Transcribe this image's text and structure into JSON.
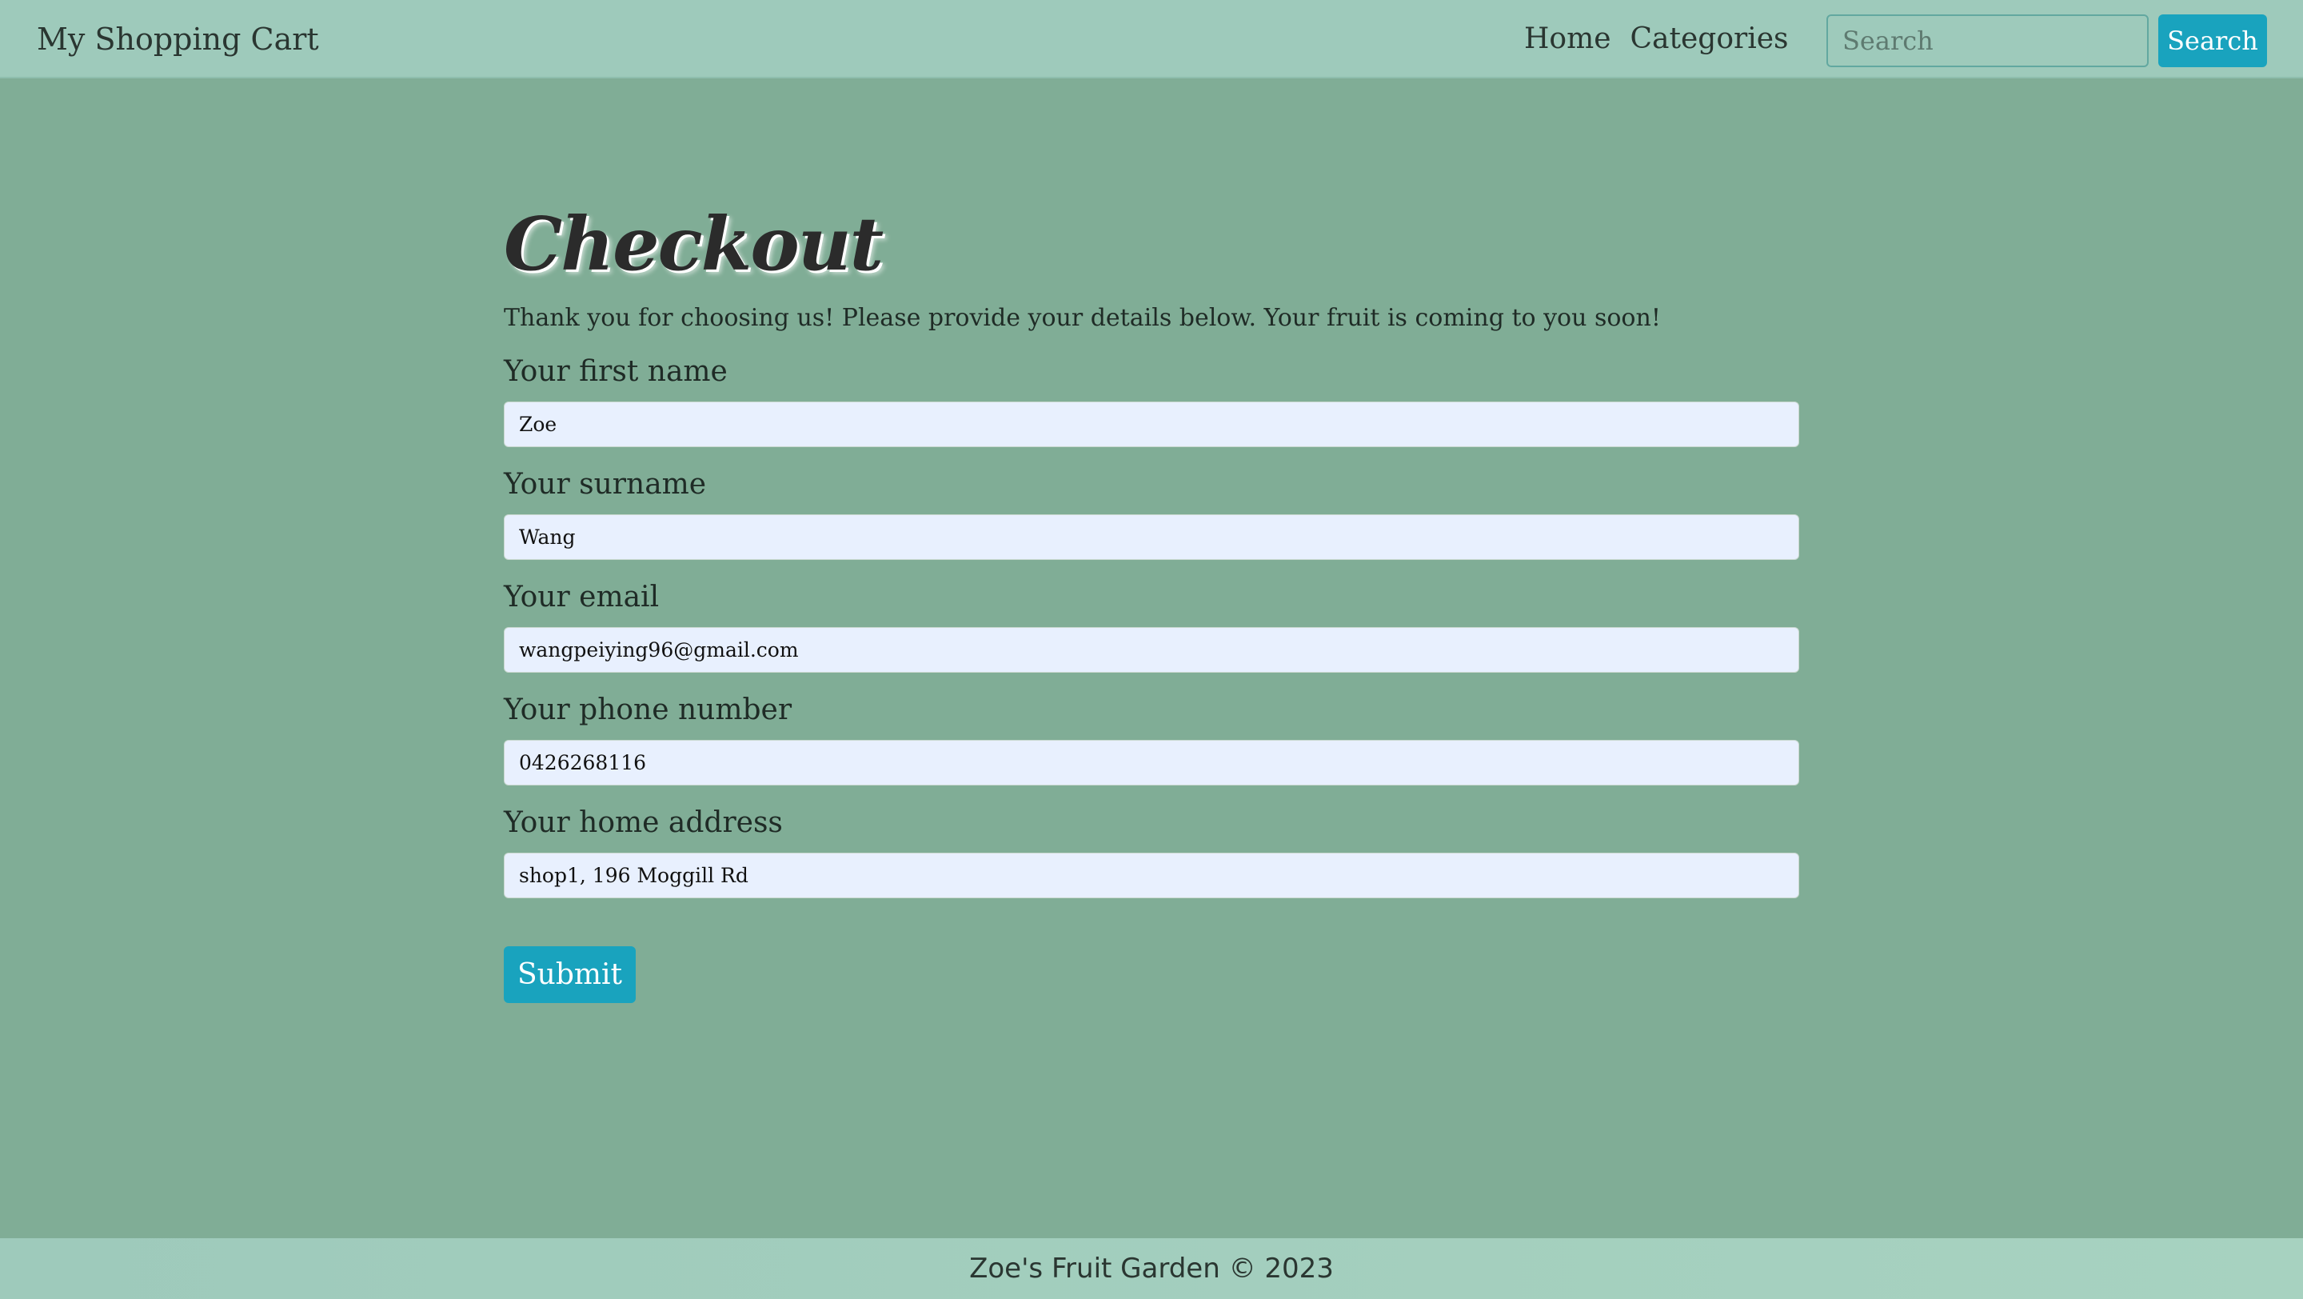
{
  "navbar": {
    "brand": "My Shopping Cart",
    "links": [
      "Home",
      "Categories"
    ],
    "search_placeholder": "Search",
    "search_button": "Search"
  },
  "checkout": {
    "title": "Checkout",
    "intro": "Thank you for choosing us! Please provide your details below. Your fruit is coming to you soon!",
    "fields": [
      {
        "label": "Your first name",
        "value": "Zoe"
      },
      {
        "label": "Your surname",
        "value": "Wang"
      },
      {
        "label": "Your email",
        "value": "wangpeiying96@gmail.com"
      },
      {
        "label": "Your phone number",
        "value": "0426268116"
      },
      {
        "label": "Your home address",
        "value": "shop1, 196 Moggill Rd"
      }
    ],
    "submit_label": "Submit"
  },
  "footer": {
    "text": "Zoe's Fruit Garden © 2023"
  },
  "colors": {
    "page_background": "#80ad96",
    "navbar_background": "#9ecabb",
    "accent": "#19a3be",
    "input_background": "#e8f0fe"
  }
}
